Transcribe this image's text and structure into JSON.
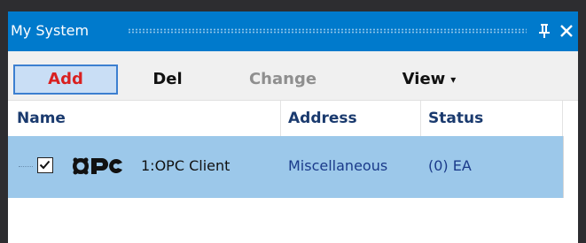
{
  "window": {
    "title": "My System"
  },
  "toolbar": {
    "add_label": "Add",
    "del_label": "Del",
    "change_label": "Change",
    "view_label": "View",
    "view_caret": "▾"
  },
  "grid": {
    "columns": [
      "Name",
      "Address",
      "Status"
    ],
    "rows": [
      {
        "checked": true,
        "icon": "opc-logo-icon",
        "name": "1:OPC Client",
        "address": "Miscellaneous",
        "status": "(0) EA"
      }
    ]
  },
  "colors": {
    "title_bar": "#007acc",
    "selected_row": "#9cc8ea",
    "add_text": "#d92020",
    "header_text": "#1a3a6e"
  }
}
